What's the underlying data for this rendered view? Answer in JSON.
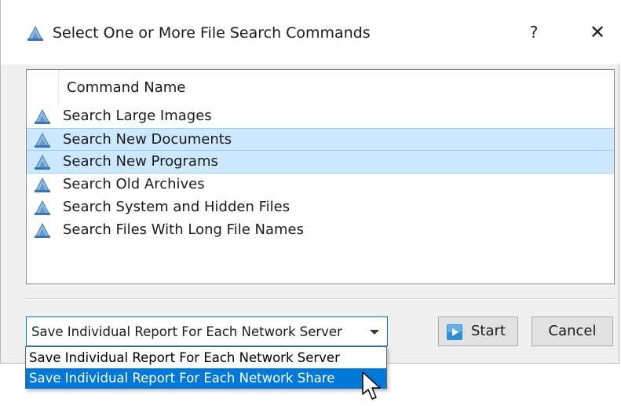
{
  "window": {
    "title": "Select One or More File Search Commands",
    "help_label": "?",
    "close_label": "✕",
    "icon": "search-command-icon"
  },
  "list": {
    "column_header": "Command Name",
    "items": [
      {
        "label": "Search Large Images",
        "selected": false
      },
      {
        "label": "Search New Documents",
        "selected": true
      },
      {
        "label": "Search New Programs",
        "selected": true
      },
      {
        "label": "Search Old Archives",
        "selected": false
      },
      {
        "label": "Search System and Hidden Files",
        "selected": false
      },
      {
        "label": "Search Files With Long File Names",
        "selected": false
      }
    ]
  },
  "report_mode": {
    "selected": "Save Individual Report For Each Network Server",
    "options": [
      "Save Individual Report For Each Network Server",
      "Save Individual Report For Each Network Share"
    ],
    "hovered_index": 1
  },
  "buttons": {
    "start_label": "Start",
    "cancel_label": "Cancel"
  },
  "colors": {
    "selection_bg": "#cce8ff",
    "accent": "#0078d7",
    "icon_blue": "#4a90c8"
  }
}
